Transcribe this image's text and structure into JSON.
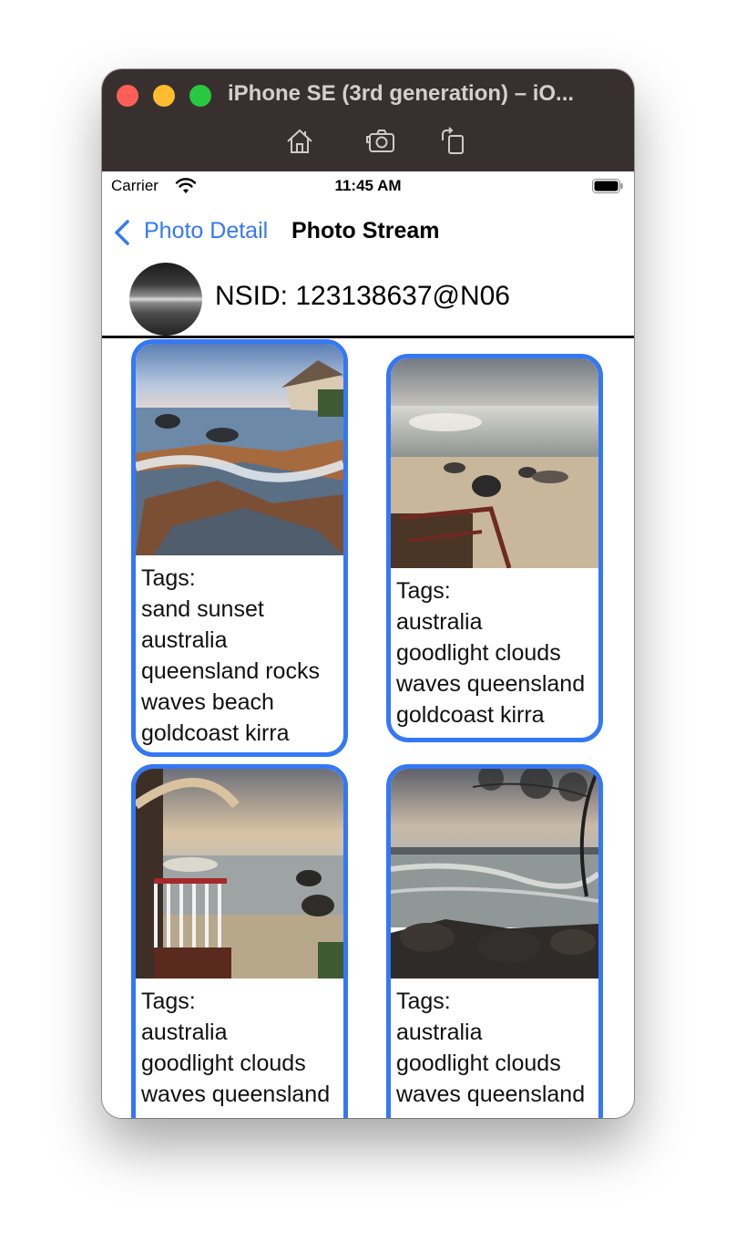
{
  "window": {
    "title": "iPhone SE (3rd generation) – iO..."
  },
  "statusbar": {
    "carrier": "Carrier",
    "time": "11:45 AM"
  },
  "navbar": {
    "back_label": "Photo Detail",
    "title": "Photo Stream"
  },
  "profile": {
    "nsid": "NSID: 123138637@N06"
  },
  "colors": {
    "accent": "#3478f6",
    "titlebar": "#38302f"
  },
  "photos": [
    {
      "tags_label": "Tags:",
      "tag_lines": [
        "sand sunset",
        "australia",
        "queensland rocks",
        "waves beach",
        "goldcoast kirra"
      ]
    },
    {
      "tags_label": "Tags:",
      "tag_lines": [
        "australia",
        "goodlight clouds",
        "waves queensland",
        "goldcoast kirra"
      ]
    },
    {
      "tags_label": "Tags:",
      "tag_lines": [
        "australia",
        "goodlight clouds",
        "waves queensland"
      ]
    },
    {
      "tags_label": "Tags:",
      "tag_lines": [
        "australia",
        "goodlight clouds",
        "waves queensland"
      ]
    }
  ]
}
